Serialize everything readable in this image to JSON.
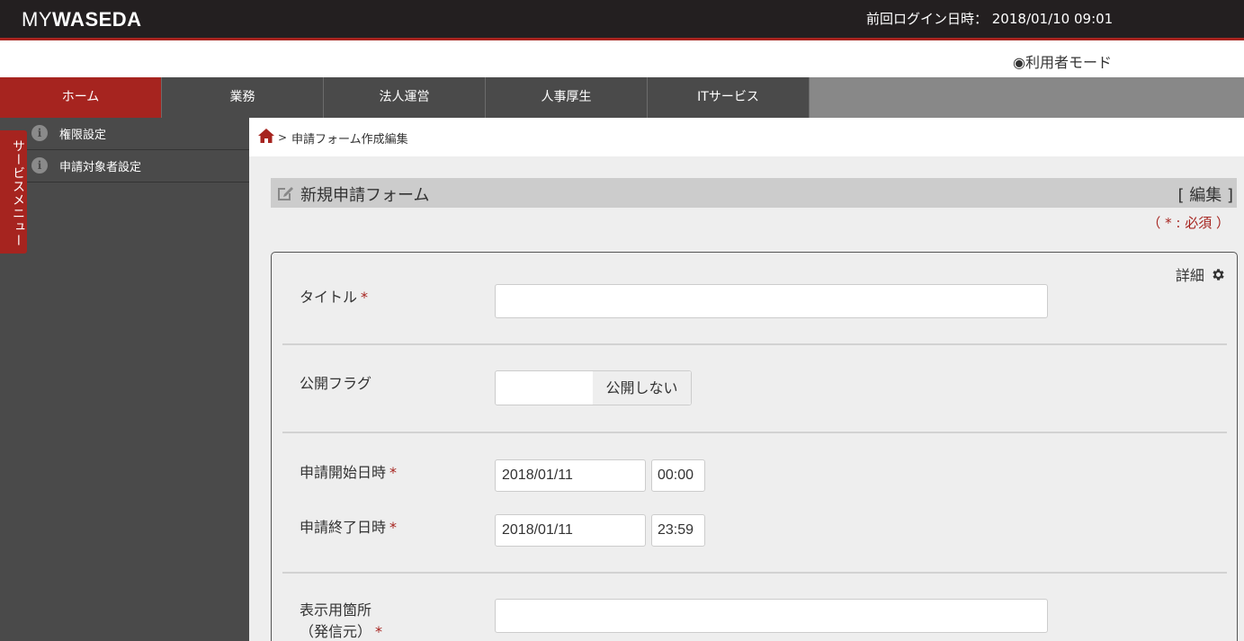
{
  "header": {
    "logo_my": "MY",
    "logo_waseda": "WASEDA",
    "last_login": "前回ログイン日時： 2018/01/10 09:01",
    "user_mode": "◉利用者モード"
  },
  "nav": {
    "items": [
      {
        "label": "ホーム"
      },
      {
        "label": "業務"
      },
      {
        "label": "法人運営"
      },
      {
        "label": "人事厚生"
      },
      {
        "label": "ITサービス"
      }
    ]
  },
  "sidebar": {
    "items": [
      {
        "label": "権限設定",
        "icon": "info-icon"
      },
      {
        "label": "申請対象者設定",
        "icon": "info-icon"
      }
    ],
    "service_menu_tab": "サービスメニュー"
  },
  "breadcrumb": {
    "separator": ">",
    "current": "申請フォーム作成編集"
  },
  "form": {
    "title": "新規申請フォーム",
    "edit_link": "[ 編集 ]",
    "required_note": "（ * : 必須 ）",
    "detail_link": "詳細",
    "required_mark": "*",
    "fields": {
      "title": {
        "label": "タイトル",
        "value": ""
      },
      "publish_flag": {
        "label": "公開フラグ",
        "value": "公開しない"
      },
      "start": {
        "label": "申請開始日時",
        "date": "2018/01/11",
        "time": "00:00"
      },
      "end": {
        "label": "申請終了日時",
        "date": "2018/01/11",
        "time": "23:59"
      },
      "display_location": {
        "label_line1": "表示用箇所",
        "label_line2": "（発信元）",
        "value": ""
      }
    }
  },
  "colors": {
    "brand_red": "#a6241f",
    "header_bg": "#231f20",
    "nav_bg": "#4a4a4a"
  }
}
